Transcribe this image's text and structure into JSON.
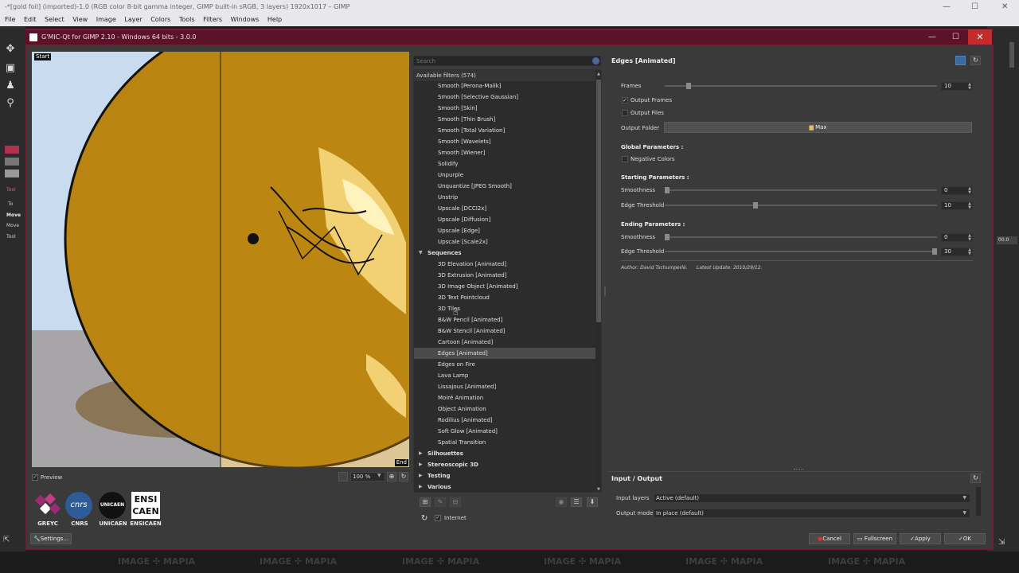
{
  "gimp": {
    "title": "-*[gold foil] (imported)-1.0 (RGB color 8-bit gamma integer, GIMP built-in sRGB, 3 layers) 1920x1017 – GIMP",
    "menu": [
      "File",
      "Edit",
      "Select",
      "View",
      "Image",
      "Layer",
      "Colors",
      "Tools",
      "Filters",
      "Windows",
      "Help"
    ],
    "side_texts": [
      "Tool",
      "To",
      "Move",
      "Move",
      "Tool "
    ],
    "right_value": "00.0"
  },
  "gmic": {
    "title": "G'MIC-Qt for GIMP 2.10 - Windows 64 bits - 3.0.0",
    "preview": {
      "start_label": "Start",
      "end_label": "End",
      "preview_label": "Preview",
      "zoom": "100 %"
    },
    "logos": [
      {
        "label": "GREYC"
      },
      {
        "label": "CNRS",
        "text": "cnrs"
      },
      {
        "label": "UNICAEN",
        "text": "UNICAEN"
      },
      {
        "label": "ENSICAEN",
        "text1": "ENSI",
        "text2": "CAEN"
      }
    ],
    "settings_label": "Settings...",
    "search_placeholder": "Search",
    "available_filters": "Available filters (574)",
    "filters": [
      {
        "label": "Smooth [Perona-Malik]",
        "kind": "leaf"
      },
      {
        "label": "Smooth [Selective Gaussian]",
        "kind": "leaf"
      },
      {
        "label": "Smooth [Skin]",
        "kind": "leaf"
      },
      {
        "label": "Smooth [Thin Brush]",
        "kind": "leaf"
      },
      {
        "label": "Smooth [Total Variation]",
        "kind": "leaf"
      },
      {
        "label": "Smooth [Wavelets]",
        "kind": "leaf"
      },
      {
        "label": "Smooth [Wiener]",
        "kind": "leaf"
      },
      {
        "label": "Solidify",
        "kind": "leaf"
      },
      {
        "label": "Unpurple",
        "kind": "leaf"
      },
      {
        "label": "Unquantize [JPEG Smooth]",
        "kind": "leaf"
      },
      {
        "label": "Unstrip",
        "kind": "leaf"
      },
      {
        "label": "Upscale [DCCI2x]",
        "kind": "leaf"
      },
      {
        "label": "Upscale [Diffusion]",
        "kind": "leaf"
      },
      {
        "label": "Upscale [Edge]",
        "kind": "leaf"
      },
      {
        "label": "Upscale [Scale2x]",
        "kind": "leaf"
      },
      {
        "label": "Sequences",
        "kind": "cat-open"
      },
      {
        "label": "3D Elevation [Animated]",
        "kind": "leaf"
      },
      {
        "label": "3D Extrusion [Animated]",
        "kind": "leaf"
      },
      {
        "label": "3D Image Object [Animated]",
        "kind": "leaf"
      },
      {
        "label": "3D Text Pointcloud",
        "kind": "leaf"
      },
      {
        "label": "3D Tiles",
        "kind": "leaf"
      },
      {
        "label": "B&W Pencil [Animated]",
        "kind": "leaf"
      },
      {
        "label": "B&W Stencil [Animated]",
        "kind": "leaf"
      },
      {
        "label": "Cartoon [Animated]",
        "kind": "leaf"
      },
      {
        "label": "Edges [Animated]",
        "kind": "leaf",
        "selected": true
      },
      {
        "label": "Edges on Fire",
        "kind": "leaf"
      },
      {
        "label": "Lava Lamp",
        "kind": "leaf"
      },
      {
        "label": "Lissajous [Animated]",
        "kind": "leaf"
      },
      {
        "label": "Moiré Animation",
        "kind": "leaf"
      },
      {
        "label": "Object Animation",
        "kind": "leaf"
      },
      {
        "label": "Rodilius [Animated]",
        "kind": "leaf"
      },
      {
        "label": "Soft Glow [Animated]",
        "kind": "leaf"
      },
      {
        "label": "Spatial Transition",
        "kind": "leaf"
      },
      {
        "label": "Silhouettes",
        "kind": "cat"
      },
      {
        "label": "Stereoscopic 3D",
        "kind": "cat"
      },
      {
        "label": "Testing",
        "kind": "cat"
      },
      {
        "label": "Various",
        "kind": "cat"
      }
    ],
    "internet_label": "Internet",
    "params": {
      "title": "Edges [Animated]",
      "frames_label": "Frames",
      "frames_value": "10",
      "frames_fraction": 0.08,
      "output_frames_label": "Output Frames",
      "output_frames_checked": "✓",
      "output_files_label": "Output Files",
      "output_folder_label": "Output Folder",
      "output_folder_value": "Max",
      "global_heading": "Global Parameters :",
      "negative_colors_label": "Negative Colors",
      "starting_heading": "Starting Parameters :",
      "start_smoothness_label": "Smoothness",
      "start_smoothness_value": "0",
      "start_smoothness_fraction": 0.0,
      "start_edge_label": "Edge Threshold",
      "start_edge_value": "10",
      "start_edge_fraction": 0.33,
      "ending_heading": "Ending Parameters :",
      "end_smoothness_label": "Smoothness",
      "end_smoothness_value": "0",
      "end_smoothness_fraction": 0.0,
      "end_edge_label": "Edge Threshold",
      "end_edge_value": "30",
      "end_edge_fraction": 1.0,
      "author": "Author: David Tschumperlé.      Latest Update: 2010/29/12."
    },
    "io": {
      "title": "Input / Output",
      "input_layers_label": "Input layers",
      "input_layers_value": "Active (default)",
      "output_mode_label": "Output mode",
      "output_mode_value": "In place (default)"
    },
    "buttons": {
      "cancel": "Cancel",
      "fullscreen": "Fullscreen",
      "apply": "Apply",
      "ok": "OK"
    }
  },
  "watermark": "IMAGE ✣ MAPIA",
  "colors": {
    "accent": "#6f1e33",
    "close": "#c42b2b",
    "gold": "#b98412",
    "sky": "#c9dcef"
  }
}
